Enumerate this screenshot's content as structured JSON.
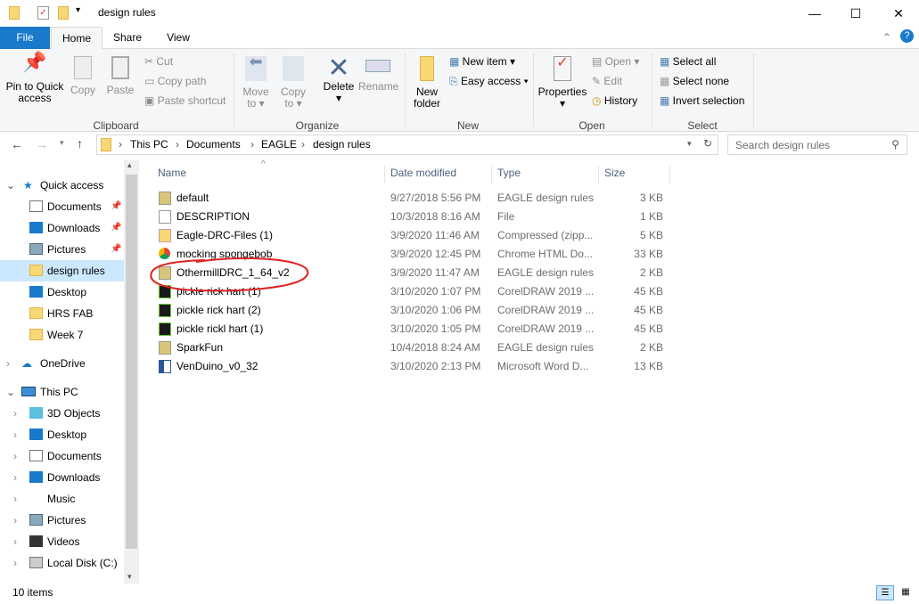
{
  "window": {
    "title": "design rules",
    "minimize": "—",
    "maximize": "☐",
    "close": "✕"
  },
  "tabs": [
    {
      "label": "File"
    },
    {
      "label": "Home"
    },
    {
      "label": "Share"
    },
    {
      "label": "View"
    }
  ],
  "ribbon": {
    "clipboard": {
      "group": "Clipboard",
      "pin": "Pin to Quick access",
      "copy": "Copy",
      "paste": "Paste",
      "cut": "Cut",
      "copy_path": "Copy path",
      "paste_shortcut": "Paste shortcut"
    },
    "organize": {
      "group": "Organize",
      "move_to": "Move to",
      "copy_to": "Copy to",
      "delete": "Delete",
      "rename": "Rename"
    },
    "new": {
      "group": "New",
      "new_folder": "New folder",
      "new_item": "New item",
      "easy_access": "Easy access"
    },
    "open": {
      "group": "Open",
      "properties": "Properties",
      "open": "Open",
      "edit": "Edit",
      "history": "History"
    },
    "select": {
      "group": "Select",
      "select_all": "Select all",
      "select_none": "Select none",
      "invert": "Invert selection"
    }
  },
  "address": {
    "crumbs": [
      "This PC",
      "Documents",
      "EAGLE",
      "design rules"
    ],
    "search_placeholder": "Search design rules"
  },
  "nav": {
    "quick_access": "Quick access",
    "quick_items": [
      {
        "label": "Documents",
        "pinned": true
      },
      {
        "label": "Downloads",
        "pinned": true
      },
      {
        "label": "Pictures",
        "pinned": true
      },
      {
        "label": "design rules",
        "selected": true
      },
      {
        "label": "Desktop"
      },
      {
        "label": "HRS FAB"
      },
      {
        "label": "Week 7"
      }
    ],
    "onedrive": "OneDrive",
    "this_pc": "This PC",
    "pc_items": [
      {
        "label": "3D Objects"
      },
      {
        "label": "Desktop"
      },
      {
        "label": "Documents"
      },
      {
        "label": "Downloads"
      },
      {
        "label": "Music"
      },
      {
        "label": "Pictures"
      },
      {
        "label": "Videos"
      },
      {
        "label": "Local Disk (C:)"
      }
    ]
  },
  "columns": {
    "name": "Name",
    "date": "Date modified",
    "type": "Type",
    "size": "Size"
  },
  "files": [
    {
      "name": "default",
      "date": "9/27/2018 5:56 PM",
      "type": "EAGLE design rules",
      "size": "3 KB",
      "icon": "dru"
    },
    {
      "name": "DESCRIPTION",
      "date": "10/3/2018 8:16 AM",
      "type": "File",
      "size": "1 KB",
      "icon": "file"
    },
    {
      "name": "Eagle-DRC-Files (1)",
      "date": "3/9/2020 11:46 AM",
      "type": "Compressed (zipp...",
      "size": "5 KB",
      "icon": "zip"
    },
    {
      "name": "mocking spongebob",
      "date": "3/9/2020 12:45 PM",
      "type": "Chrome HTML Do...",
      "size": "33 KB",
      "icon": "chrome"
    },
    {
      "name": "OthermillDRC_1_64_v2",
      "date": "3/9/2020 11:47 AM",
      "type": "EAGLE design rules",
      "size": "2 KB",
      "icon": "dru"
    },
    {
      "name": "pickle rick hart (1)",
      "date": "3/10/2020 1:07 PM",
      "type": "CorelDRAW 2019 ...",
      "size": "45 KB",
      "icon": "corel"
    },
    {
      "name": "pickle rick hart (2)",
      "date": "3/10/2020 1:06 PM",
      "type": "CorelDRAW 2019 ...",
      "size": "45 KB",
      "icon": "corel"
    },
    {
      "name": "pickle rickl hart (1)",
      "date": "3/10/2020 1:05 PM",
      "type": "CorelDRAW 2019 ...",
      "size": "45 KB",
      "icon": "corel"
    },
    {
      "name": "SparkFun",
      "date": "10/4/2018 8:24 AM",
      "type": "EAGLE design rules",
      "size": "2 KB",
      "icon": "dru"
    },
    {
      "name": "VenDuino_v0_32",
      "date": "3/10/2020 2:13 PM",
      "type": "Microsoft Word D...",
      "size": "13 KB",
      "icon": "word"
    }
  ],
  "status": {
    "count": "10 items"
  },
  "colors": {
    "accent": "#1979ca",
    "selection": "#cce8ff",
    "annotation": "#e02020"
  }
}
